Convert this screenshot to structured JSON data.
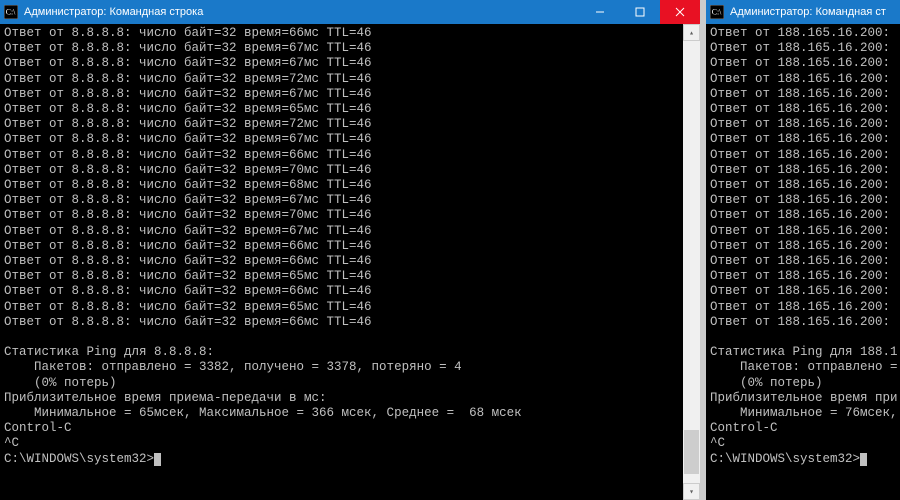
{
  "left": {
    "title": "Администратор: Командная строка",
    "ping_ip": "8.8.8.8",
    "replies": [
      {
        "time": "66",
        "ttl": "46"
      },
      {
        "time": "67",
        "ttl": "46"
      },
      {
        "time": "67",
        "ttl": "46"
      },
      {
        "time": "72",
        "ttl": "46"
      },
      {
        "time": "67",
        "ttl": "46"
      },
      {
        "time": "65",
        "ttl": "46"
      },
      {
        "time": "72",
        "ttl": "46"
      },
      {
        "time": "67",
        "ttl": "46"
      },
      {
        "time": "66",
        "ttl": "46"
      },
      {
        "time": "70",
        "ttl": "46"
      },
      {
        "time": "68",
        "ttl": "46"
      },
      {
        "time": "67",
        "ttl": "46"
      },
      {
        "time": "70",
        "ttl": "46"
      },
      {
        "time": "67",
        "ttl": "46"
      },
      {
        "time": "66",
        "ttl": "46"
      },
      {
        "time": "66",
        "ttl": "46"
      },
      {
        "time": "65",
        "ttl": "46"
      },
      {
        "time": "66",
        "ttl": "46"
      },
      {
        "time": "65",
        "ttl": "46"
      },
      {
        "time": "66",
        "ttl": "46"
      }
    ],
    "stats_header": "Статистика Ping для 8.8.8.8:",
    "stats_packets": "    Пакетов: отправлено = 3382, получено = 3378, потеряно = 4",
    "stats_loss": "    (0% потерь)",
    "stats_rtt_header": "Приблизительное время приема-передачи в мс:",
    "stats_rtt": "    Минимальное = 65мсек, Максимальное = 366 мсек, Среднее =  68 мсек",
    "ctrlc": "Control-C",
    "caret": "^C",
    "prompt": "C:\\WINDOWS\\system32>"
  },
  "right": {
    "title": "Администратор: Командная ст",
    "ping_ip": "188.165.16.200",
    "reply_prefix": "Ответ от 188.165.16.200:",
    "reply_count": 20,
    "stats_header": "Статистика Ping для 188.1",
    "stats_packets": "    Пакетов: отправлено =",
    "stats_loss": "    (0% потерь)",
    "stats_rtt_header": "Приблизительное время при",
    "stats_rtt": "    Минимальное = 76мсек,",
    "ctrlc": "Control-C",
    "caret": "^C",
    "prompt": "C:\\WINDOWS\\system32>"
  }
}
